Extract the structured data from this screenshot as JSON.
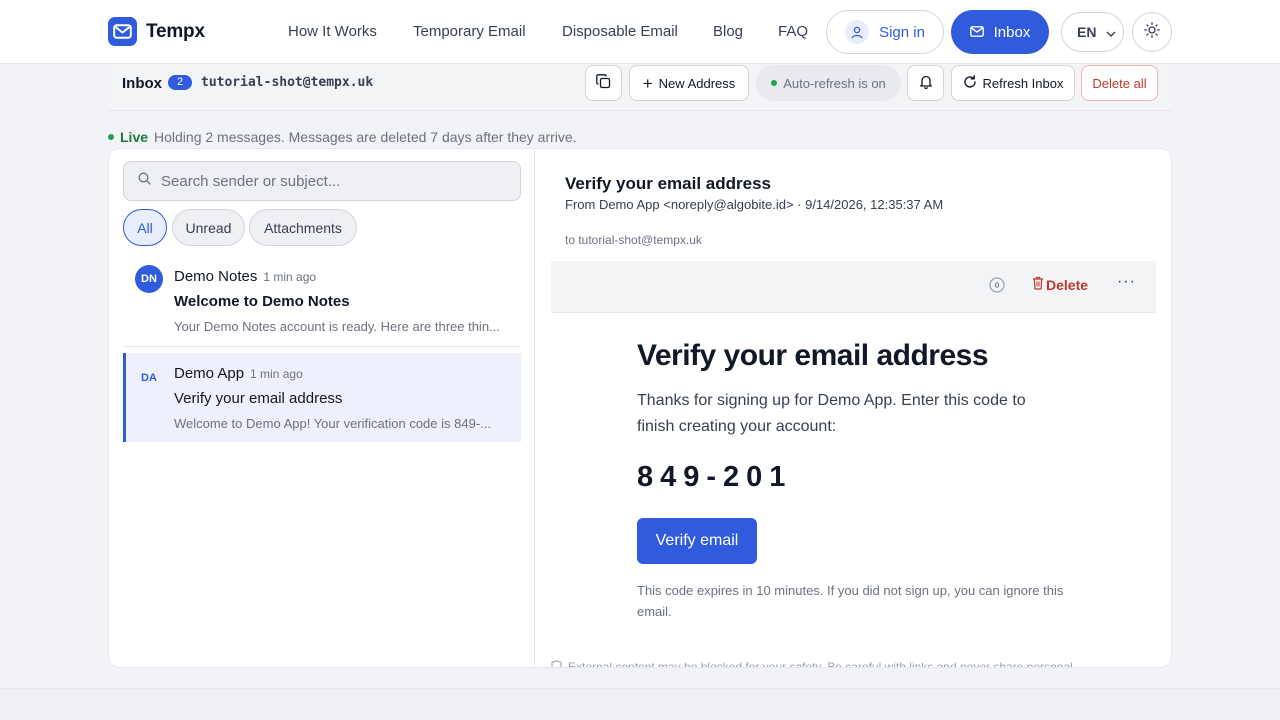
{
  "brand": {
    "name": "Tempx",
    "accent": "#2f5bdc"
  },
  "nav": {
    "links": [
      "How It Works",
      "Temporary Email",
      "Disposable Email",
      "Blog",
      "FAQ"
    ],
    "sign_in": "Sign in",
    "inbox": "Inbox",
    "language": "EN"
  },
  "toolbar": {
    "title": "Inbox",
    "count": "2",
    "address": "tutorial-shot@tempx.uk",
    "new_address": "New Address",
    "auto_refresh": "Auto-refresh is on",
    "refresh": "Refresh Inbox",
    "delete_all": "Delete all"
  },
  "status": {
    "live": "Live",
    "text": "Holding 2 messages. Messages are deleted 7 days after they arrive."
  },
  "list": {
    "search_placeholder": "Search sender or subject...",
    "filters": [
      "All",
      "Unread",
      "Attachments"
    ],
    "messages": [
      {
        "initials": "DN",
        "from": "Demo Notes",
        "ago": "1 min ago",
        "subject": "Welcome to Demo Notes",
        "preview": "Your Demo Notes account is ready. Here are three thin..."
      },
      {
        "initials": "DA",
        "from": "Demo App",
        "ago": "1 min ago",
        "subject": "Verify your email address",
        "preview": "Welcome to Demo App! Your verification code is 849-..."
      }
    ]
  },
  "reader": {
    "subject": "Verify your email address",
    "meta": "From Demo App <noreply@algobite.id> · 9/14/2026, 12:35:37 AM",
    "to": "to tutorial-shot@tempx.uk",
    "timer": "0",
    "delete": "Delete",
    "body": {
      "heading": "Verify your email address",
      "intro": "Thanks for signing up for Demo App. Enter this code to finish creating your account:",
      "code": "849-201",
      "button": "Verify email",
      "note": "This code expires in 10 minutes. If you did not sign up, you can ignore this email."
    },
    "warning": "External content may be blocked for your safety. Be careful with links and never share personal"
  }
}
